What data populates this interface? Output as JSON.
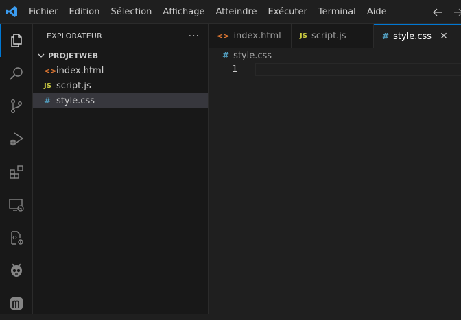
{
  "menubar": {
    "items": [
      "Fichier",
      "Edition",
      "Sélection",
      "Affichage",
      "Atteindre",
      "Exécuter",
      "Terminal",
      "Aide"
    ]
  },
  "sidebar": {
    "title": "EXPLORATEUR",
    "more": "···",
    "folder": "PROJETWEB",
    "files": [
      {
        "icon": "<>",
        "name": "index.html",
        "color": "#e37933"
      },
      {
        "icon": "JS",
        "name": "script.js",
        "color": "#cbcb41"
      },
      {
        "icon": "#",
        "name": "style.css",
        "color": "#519aba"
      }
    ]
  },
  "tabs": [
    {
      "icon": "<>",
      "label": "index.html",
      "color": "#e37933"
    },
    {
      "icon": "JS",
      "label": "script.js",
      "color": "#cbcb41"
    },
    {
      "icon": "#",
      "label": "style.css",
      "color": "#519aba",
      "close": "✕"
    }
  ],
  "editor": {
    "breadcrumb": {
      "icon": "#",
      "label": "style.css"
    },
    "line_numbers": [
      "1"
    ]
  },
  "colors": {
    "accent": "#0078d4",
    "background": "#1f1f1f",
    "sidebar": "#181818"
  }
}
